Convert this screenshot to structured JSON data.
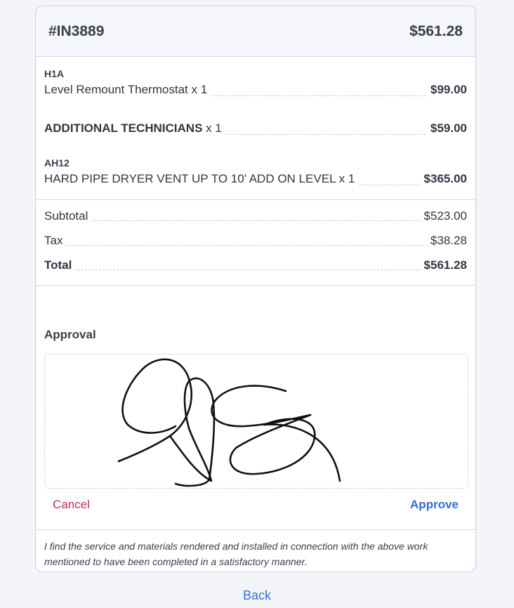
{
  "invoice": {
    "number": "#IN3889",
    "total": "$561.28"
  },
  "items": [
    {
      "code": "H1A",
      "description": "Level Remount Thermostat",
      "qty": "x 1",
      "price": "$99.00"
    },
    {
      "code": "",
      "description": "ADDITIONAL TECHNICIANS",
      "qty": "x 1",
      "price": "$59.00"
    },
    {
      "code": "AH12",
      "description": "HARD PIPE DRYER VENT UP TO 10' ADD ON LEVEL",
      "qty": "x 1",
      "price": "$365.00"
    }
  ],
  "totals": {
    "subtotal_label": "Subtotal",
    "subtotal_value": "$523.00",
    "tax_label": "Tax",
    "tax_value": "$38.28",
    "total_label": "Total",
    "total_value": "$561.28"
  },
  "approval": {
    "label": "Approval",
    "cancel_label": "Cancel",
    "approve_label": "Approve"
  },
  "disclaimer": "I find the service and materials rendered and installed in connection with the above work mentioned to have been completed in a satisfactory manner.",
  "back_label": "Back",
  "colors": {
    "accent": "#2f6fd6",
    "danger": "#b8334a",
    "border": "#c9cfe0"
  }
}
